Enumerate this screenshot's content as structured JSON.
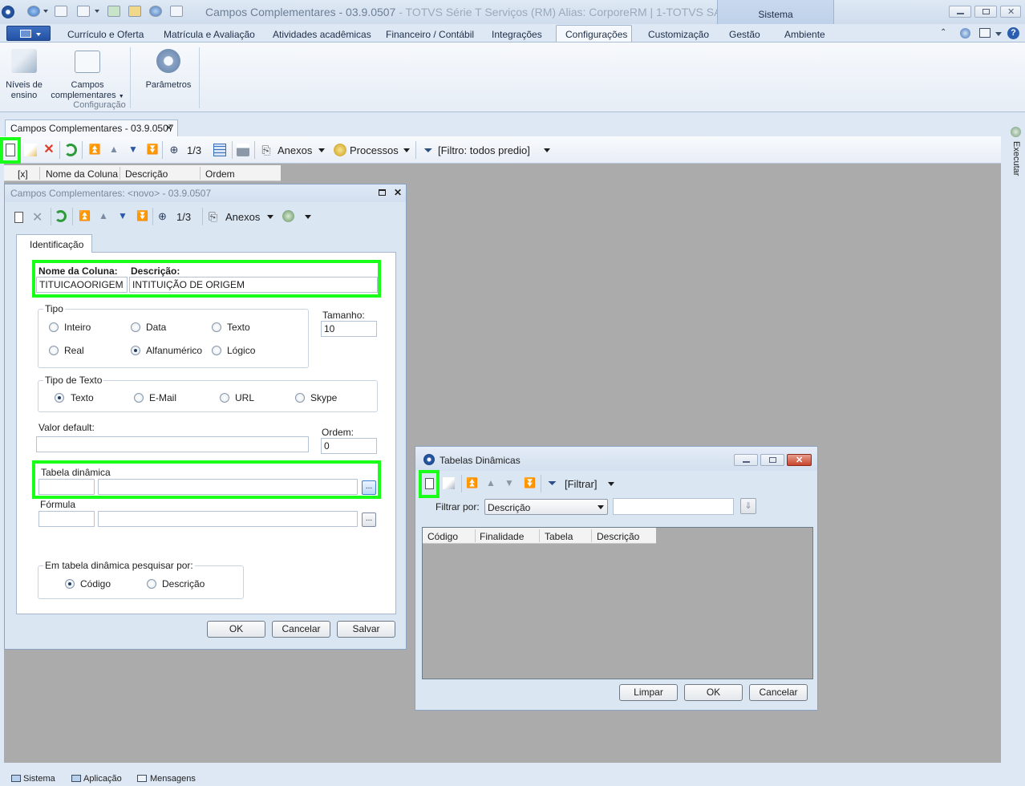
{
  "window": {
    "title": "Campos Complementares - 03.9.0507",
    "title_suffix": " - TOTVS Série T Serviços (RM) Alias: CorporeRM | 1-TOTVS SA",
    "context_tab": "Sistema"
  },
  "ribbon": {
    "tabs": [
      "Currículo e Oferta",
      "Matrícula e Avaliação",
      "Atividades acadêmicas",
      "Financeiro / Contábil",
      "Integrações",
      "Configurações",
      "Customização",
      "Gestão",
      "Ambiente"
    ],
    "active_tab": "Configurações",
    "buttons": {
      "niveis_line1": "Níveis de",
      "niveis_line2": "ensino",
      "campos_line1": "Campos",
      "campos_line2": "complementares",
      "parametros": "Parâmetros"
    },
    "group_label": "Configuração"
  },
  "doc_tab": {
    "label": "Campos Complementares - 03.9.0507",
    "close": "✕"
  },
  "main_toolbar": {
    "record_counter": "1/3",
    "anexos": "Anexos",
    "processos": "Processos",
    "filtro": "[Filtro: todos predio]"
  },
  "grid": {
    "columns": [
      "[x]",
      "Nome da Coluna",
      "Descrição",
      "Ordem"
    ]
  },
  "side_panel": {
    "label": "Executar"
  },
  "status_bar": {
    "items": [
      "Sistema",
      "Aplicação",
      "Mensagens"
    ]
  },
  "dialog_campos": {
    "title": "Campos Complementares: <novo> - 03.9.0507",
    "record_counter": "1/3",
    "anexos": "Anexos",
    "tab": "Identificação",
    "nome_coluna_label": "Nome da Coluna:",
    "nome_coluna_value": "TITUICAOORIGEM",
    "descricao_label": "Descrição:",
    "descricao_value": "INTITUIÇÃO DE ORIGEM",
    "tipo": {
      "legend": "Tipo",
      "options": [
        "Inteiro",
        "Data",
        "Texto",
        "Real",
        "Alfanumérico",
        "Lógico"
      ],
      "selected": "Alfanumérico"
    },
    "tamanho_label": "Tamanho:",
    "tamanho_value": "10",
    "tipo_texto": {
      "legend": "Tipo de Texto",
      "options": [
        "Texto",
        "E-Mail",
        "URL",
        "Skype"
      ],
      "selected": "Texto"
    },
    "valor_default_label": "Valor default:",
    "valor_default_value": "",
    "ordem_label": "Ordem:",
    "ordem_value": "0",
    "tabela_dinamica_label": "Tabela dinâmica",
    "formula_label": "Fórmula",
    "ellipsis": "...",
    "pesquisar": {
      "legend": "Em tabela dinâmica pesquisar por:",
      "options": [
        "Código",
        "Descrição"
      ],
      "selected": "Código"
    },
    "ok": "OK",
    "cancelar": "Cancelar",
    "salvar": "Salvar"
  },
  "dialog_tabelas": {
    "title": "Tabelas Dinâmicas",
    "filtrar": "[Filtrar]",
    "filtrar_por_label": "Filtrar por:",
    "filtrar_por_value": "Descrição",
    "search_value": "",
    "columns": [
      "Código",
      "Finalidade",
      "Tabela",
      "Descrição"
    ],
    "limpar": "Limpar",
    "ok": "OK",
    "cancelar": "Cancelar"
  },
  "colors": {
    "highlight": "#1aff1a",
    "workspace": "#ababab",
    "app_menu": "#2352a4"
  }
}
